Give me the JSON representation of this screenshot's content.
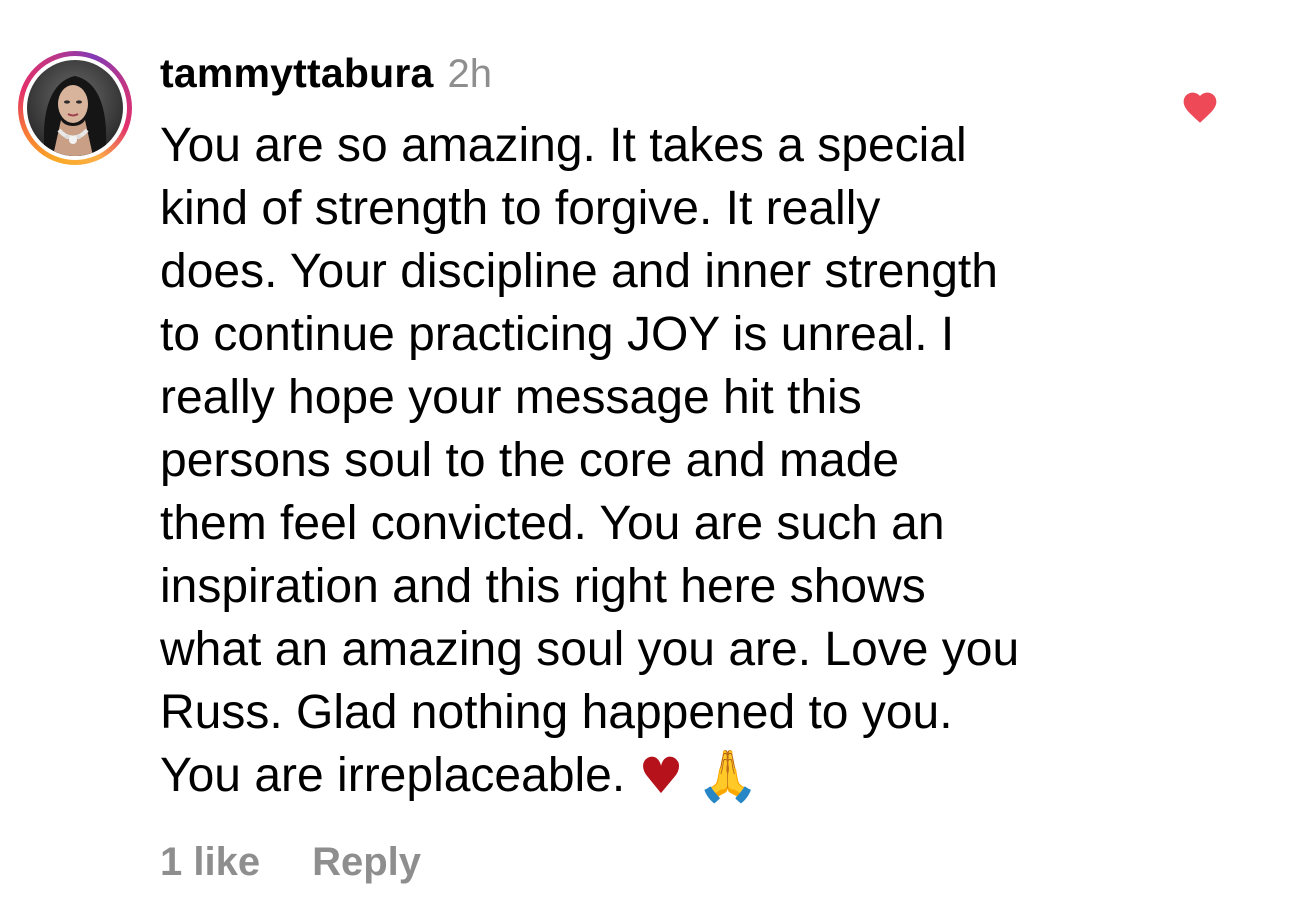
{
  "comment": {
    "username": "tammyttabura",
    "timestamp": "2h",
    "text": "You are so amazing. It takes a special\nkind of strength to forgive. It really\ndoes. Your discipline and inner strength\nto continue practicing JOY is unreal. I\nreally hope your message hit this\npersons soul to the core and made\nthem feel convicted. You are such an\ninspiration and this right here shows\nwhat an amazing soul you are. Love you\nRuss. Glad nothing happened to you.\nYou are irreplaceable.",
    "emojis": [
      "♥",
      "🙏"
    ],
    "liked": true
  },
  "footer": {
    "likes_label": "1 like",
    "reply_label": "Reply"
  },
  "icons": {
    "like": "heart-icon",
    "avatar": "avatar-photo"
  },
  "colors": {
    "heart": "#ed4956",
    "secondary_text": "#8e8e8e",
    "primary_text": "#000000"
  }
}
